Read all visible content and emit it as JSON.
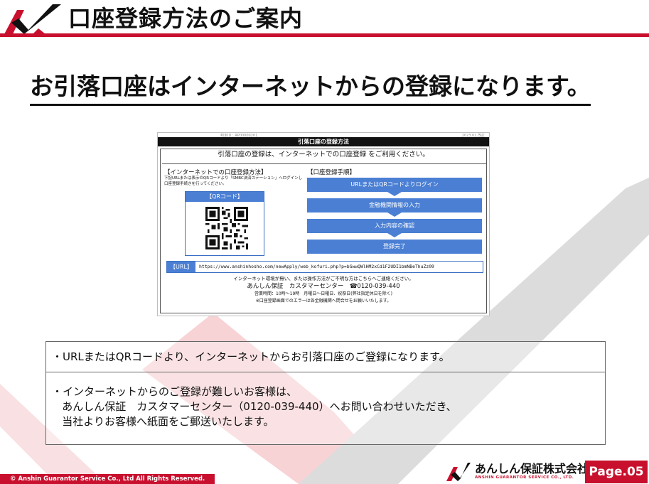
{
  "header": {
    "title": "口座登録方法のご案内",
    "accent_color": "#c8102e"
  },
  "headline": "お引落口座はインターネットからの登録になります。",
  "document": {
    "ref": "判定ID：RP00000201",
    "date": "2023.01 改訂",
    "title": "引落口座の登録方法",
    "intro": "引落口座の登録は、インターネットでの口座登録 をご利用ください。",
    "left_title": "【インターネットでの口座登録方法】",
    "left_desc": "下記URLまたは表示のQRコードより「SMBC決済ステーション」へログインし口座登録手続きを行ってください。",
    "qr_label": "【QRコード】",
    "right_title": "【口座登録手順】",
    "steps": [
      "URLまたはQRコードよりログイン",
      "金融機関情報の入力",
      "入力内容の確認",
      "登録完了"
    ],
    "url_label": "【URL】",
    "url": "https://www.anshinhosho.com/newApply/web_kofuri.php?p=bGwwQWlHM2xCd1F2UDI1bmNBeThuZz09",
    "contact_note": "インターネット環境が無い、または操作方法がご不明な方はこちらへご連絡ください。",
    "contact_name": "あんしん保証　カスタマーセンター　☎0120-039-440",
    "hours": "営業時間：10時～19時　月曜日～日曜日、祝祭日(弊社指定休日を除く)",
    "error_note": "※口座登録画面でのエラーは各金融機関へ問合せをお願いいたします。"
  },
  "notes": {
    "note1": "・URLまたはQRコードより、インターネットからお引落口座のご登録になります。",
    "note2_lines": [
      "・インターネットからのご登録が難しいお客様は、",
      "   あんしん保証　カスタマーセンター（0120-039-440）へお問い合わせいただき、",
      "   当社よりお客様へ紙面をご郵送いたします。"
    ]
  },
  "footer": {
    "copyright": "© Anshin Guarantor Service Co., Ltd All Rights Reserved.",
    "company": "あんしん保証株式会社",
    "company_en": "ANSHIN GUARANTOR SERVICE CO., LTD.",
    "page": "Page.05"
  }
}
